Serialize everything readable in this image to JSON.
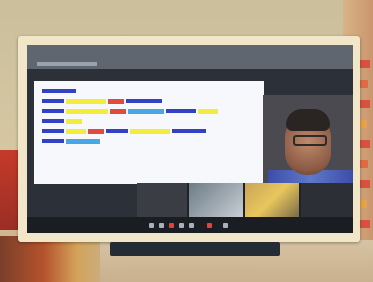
{
  "scene": {
    "description_visible_text": [],
    "colors": {
      "slide_background": "#f7f8fb",
      "highlight_yellow": "#f4ec3b",
      "highlight_blue": "#49a7e6",
      "highlight_red": "#e24a3d",
      "code_text": "#3342c5",
      "screen_dark": "#2b3039",
      "monitor_bezel": "#f1e6c8"
    },
    "icons": [
      "camera-icon",
      "microphone-icon",
      "share-screen-icon",
      "end-call-icon",
      "chat-icon",
      "participants-icon"
    ]
  }
}
